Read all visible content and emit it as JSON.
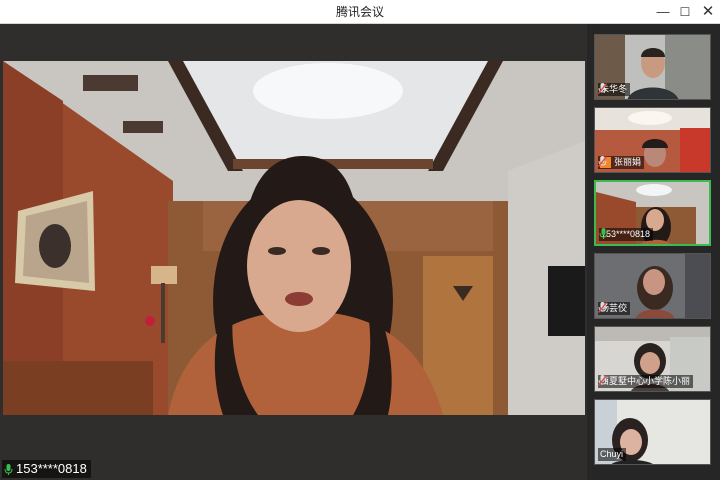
{
  "window": {
    "title": "腾讯会议"
  },
  "controls": {
    "minimize": "—",
    "maximize": "☐",
    "close": "✕"
  },
  "main": {
    "speaker_label": "153****0818",
    "mic_icon": "mic-active-icon"
  },
  "participants": [
    {
      "name": "朱华冬",
      "mic": "mic-muted-icon",
      "active": false
    },
    {
      "name": "张丽娟",
      "mic": "mic-muted-icon",
      "active": false,
      "avatar_badge": true
    },
    {
      "name": "153****0818",
      "mic": "mic-active-icon",
      "active": true
    },
    {
      "name": "杨芸佼",
      "mic": "mic-muted-icon",
      "active": false
    },
    {
      "name": "西夏墅中心小学陈小丽",
      "mic": "mic-muted-icon",
      "active": false
    },
    {
      "name": "Chuyi",
      "mic": "",
      "active": false
    }
  ],
  "colors": {
    "active_border": "#3dbb4e",
    "mic_active": "#3dbb4e",
    "mic_muted": "#e04a4a"
  }
}
